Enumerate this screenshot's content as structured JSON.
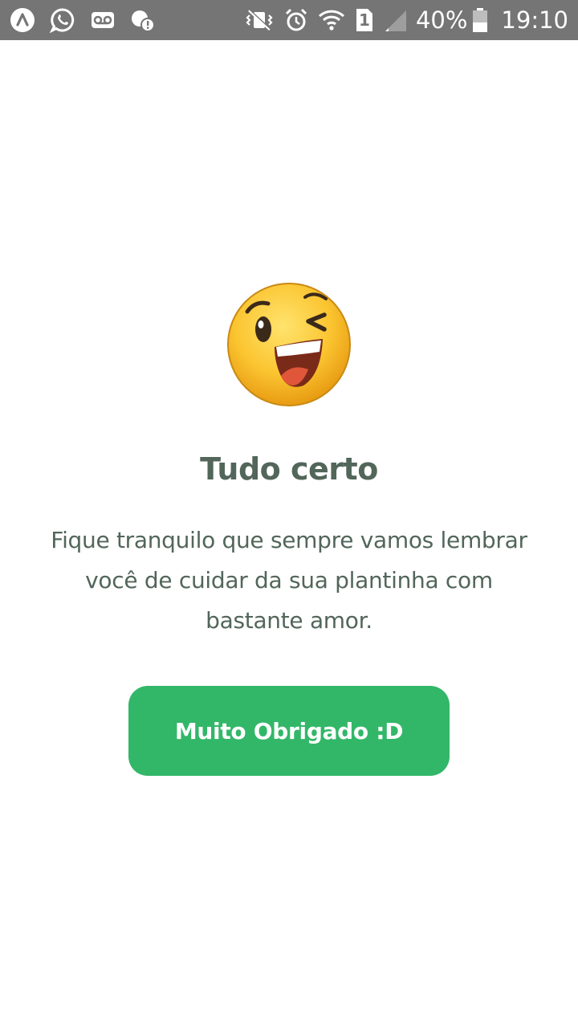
{
  "status_bar": {
    "battery_percent": "40%",
    "time": "19:10",
    "sim_slot": "1",
    "left_icons": [
      "app-launcher-icon",
      "whatsapp-icon",
      "voicemail-icon",
      "sync-alert-icon"
    ],
    "right_icons": [
      "vibrate-mute-icon",
      "alarm-icon",
      "wifi-icon",
      "sim-icon",
      "signal-icon",
      "battery-icon"
    ]
  },
  "main": {
    "emoji": "winking-laughing-face",
    "title": "Tudo certo",
    "subtitle": "Fique tranquilo que sempre vamos lembrar você de cuidar da sua plantinha com bastante amor.",
    "button_label": "Muito Obrigado :D"
  },
  "colors": {
    "heading": "#52665A",
    "button": "#32B768",
    "status_bar": "#757575"
  }
}
